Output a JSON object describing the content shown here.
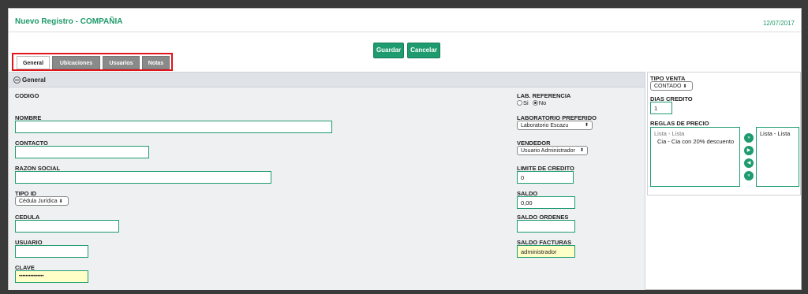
{
  "header": {
    "title": "Nuevo Registro - COMPAÑIA",
    "date": "12/07/2017"
  },
  "toolbar": {
    "save_label": "Guardar",
    "cancel_label": "Cancelar"
  },
  "tabs": [
    {
      "label": "General",
      "active": true
    },
    {
      "label": "Ubicaciones",
      "active": false
    },
    {
      "label": "Usuarios",
      "active": false
    },
    {
      "label": "Notas",
      "active": false
    }
  ],
  "section": {
    "title": "General"
  },
  "left_fields": {
    "codigo": {
      "label": "CODIGO"
    },
    "nombre": {
      "label": "NOMBRE",
      "value": ""
    },
    "contacto": {
      "label": "CONTACTO",
      "value": ""
    },
    "razon_social": {
      "label": "RAZON SOCIAL",
      "value": ""
    },
    "tipo_id": {
      "label": "TIPO ID",
      "value": "Cédula Jurídica"
    },
    "cedula": {
      "label": "CEDULA",
      "value": ""
    },
    "usuario": {
      "label": "USUARIO",
      "value": ""
    },
    "clave": {
      "label": "CLAVE",
      "value": "•••••••••••••••"
    }
  },
  "middle_fields": {
    "lab_referencia": {
      "label": "LAB. REFERENCIA",
      "opt_si": "Si",
      "opt_no": "No",
      "selected": "No"
    },
    "laboratorio_preferido": {
      "label": "LABORATORIO PREFERIDO",
      "value": "Laboratorio Escazu"
    },
    "vendedor": {
      "label": "VENDEDOR",
      "value": "Usuario Administrador"
    },
    "limite_credito": {
      "label": "LIMITE DE CREDITO",
      "value": "0"
    },
    "saldo": {
      "label": "SALDO",
      "value": "0,00"
    },
    "saldo_ordenes": {
      "label": "SALDO ORDENES",
      "value": ""
    },
    "saldo_facturas": {
      "label": "SALDO FACTURAS",
      "value": "administrador"
    }
  },
  "side": {
    "tipo_venta": {
      "label": "TIPO VENTA",
      "value": "CONTADO"
    },
    "dias_credito": {
      "label": "DIAS CREDITO",
      "value": "1"
    },
    "reglas_precio": {
      "label": "REGLAS DE PRECIO",
      "available_header": "Lista - Lista",
      "available_item": "Cia - Cia con 20% descuento",
      "selected_item": "Lista - Lista"
    }
  },
  "icons": {
    "move_all_right": "double-chevron-right-icon",
    "move_right": "chevron-right-icon",
    "move_left": "chevron-left-icon",
    "move_all_left": "double-chevron-left-icon"
  },
  "colors": {
    "accent": "#1f9c6f",
    "highlight": "#e0141a",
    "yellow_field": "#ffffc8"
  }
}
